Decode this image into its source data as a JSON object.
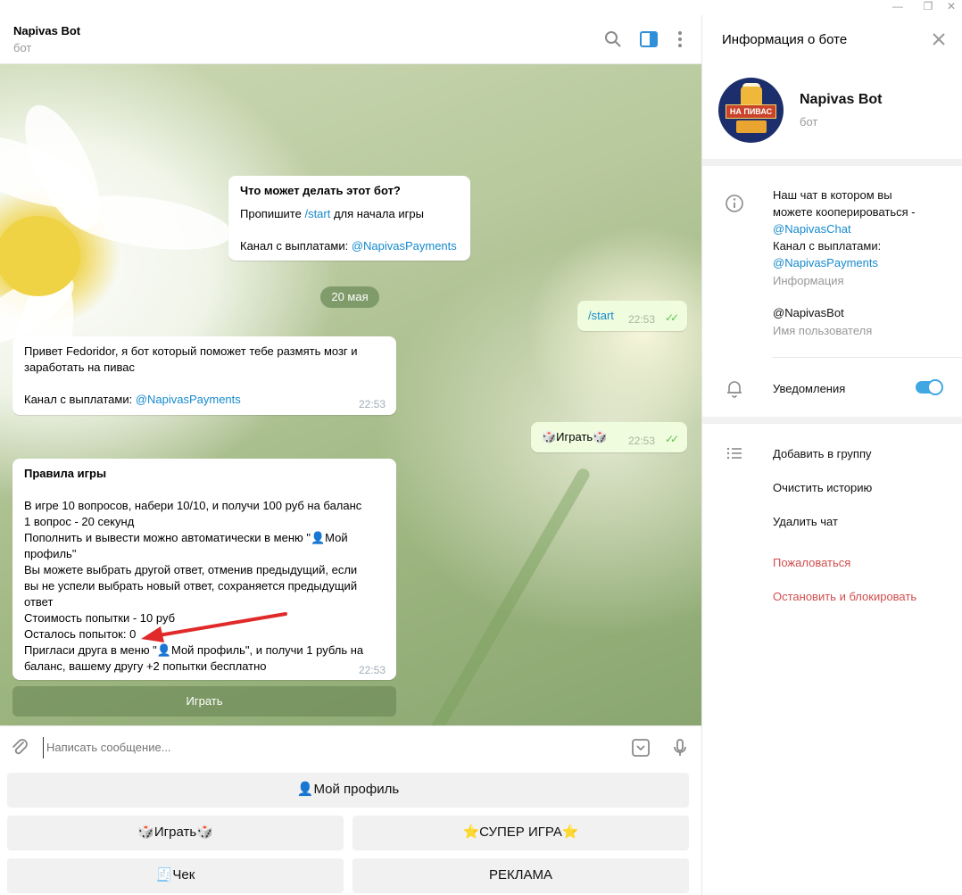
{
  "window": {
    "min_glyph": "—",
    "restore_glyph": "❐",
    "close_glyph": "✕"
  },
  "chat": {
    "title": "Napivas Bot",
    "subtitle": "бот"
  },
  "messages": {
    "intro": {
      "title": "Что может делать этот бот?",
      "line1_prefix": "Пропишите ",
      "line1_link": "/start",
      "line1_suffix": " для начала игры",
      "line2_prefix": "Канал с выплатами: ",
      "line2_link": "@NapivasPayments"
    },
    "date_pill": "20 мая",
    "out_start": {
      "text": "/start",
      "time": "22:53"
    },
    "greeting": {
      "line1": "Привет Fedoridor, я бот который поможет тебе размять мозг и",
      "line2": "заработать на пивас",
      "line3_prefix": "Канал с выплатами: ",
      "line3_link": "@NapivasPayments",
      "time": "22:53"
    },
    "out_play": {
      "text": "🎲Играть🎲",
      "time": "22:53"
    },
    "rules": {
      "title": "Правила игры",
      "lines": [
        "В игре 10 вопросов, набери 10/10, и получи 100 руб на баланс",
        "1 вопрос - 20 секунд",
        "Пополнить и вывести можно автоматически в меню \"👤Мой",
        "профиль\"",
        "Вы можете выбрать другой ответ, отменив предыдущий, если",
        "вы не успели выбрать новый ответ, сохраняется предыдущий",
        "ответ",
        "Стоимость попытки - 10 руб",
        "Осталось попыток: 0",
        "Пригласи друга в меню \"👤Мой профиль\", и получи 1 рубль на",
        "баланс, вашему другу +2 попытки бесплатно"
      ],
      "time": "22:53"
    },
    "inline_button": "Играть"
  },
  "composer": {
    "placeholder": "Написать сообщение..."
  },
  "keyboard": {
    "profile": "👤Мой профиль",
    "play": "🎲Играть🎲",
    "super_game": "⭐СУПЕР ИГРА⭐",
    "check": "🧾Чек",
    "ads": "РЕКЛАМА"
  },
  "panel": {
    "title": "Информация о боте",
    "name": "Napivas Bot",
    "subtitle": "бот",
    "avatar_badge": "НА ПИВАС",
    "info_line1": "Наш чат в котором вы",
    "info_line2": "можете кооперироваться -",
    "info_link1": "@NapivasChat",
    "info_line3": "Канал с выплатами:",
    "info_link2": "@NapivasPayments",
    "info_label": "Информация",
    "username": "@NapivasBot",
    "username_label": "Имя пользователя",
    "notifications": "Уведомления",
    "notifications_on": true,
    "actions": {
      "add_group": "Добавить в группу",
      "clear_history": "Очистить историю",
      "delete_chat": "Удалить чат",
      "report": "Пожаловаться",
      "stop_block": "Остановить и блокировать"
    }
  },
  "colors": {
    "accent": "#40a7e3",
    "link": "#168acd",
    "danger": "#d14e4e",
    "arrow": "#e02a2a",
    "check": "#5dc452"
  }
}
